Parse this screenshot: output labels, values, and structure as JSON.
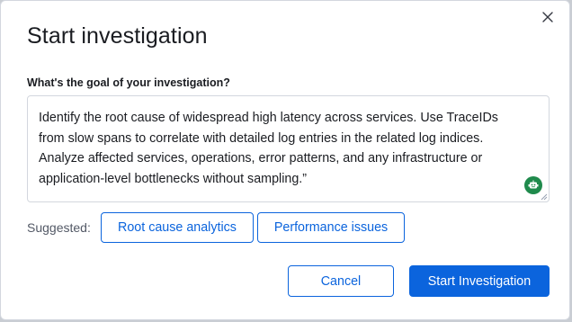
{
  "modal": {
    "title": "Start investigation",
    "close_icon": "close-icon"
  },
  "goal": {
    "question": "What's the goal of your investigation?",
    "value": "Identify the root cause of widespread high latency across services. Use TraceIDs\nfrom slow spans to correlate with detailed log entries in the related log indices.\nAnalyze affected services, operations, error patterns, and any infrastructure or\napplication-level bottlenecks without sampling.”",
    "assistant_icon": "robot-icon",
    "assistant_color": "#1f8a4c"
  },
  "suggested": {
    "label": "Suggested:",
    "chips": [
      {
        "label": "Root cause analytics"
      },
      {
        "label": "Performance issues"
      }
    ]
  },
  "footer": {
    "cancel_label": "Cancel",
    "start_label": "Start Investigation"
  },
  "colors": {
    "primary": "#0b64dd",
    "text": "#1a1c21",
    "muted": "#535966",
    "border": "#d3d7de"
  }
}
